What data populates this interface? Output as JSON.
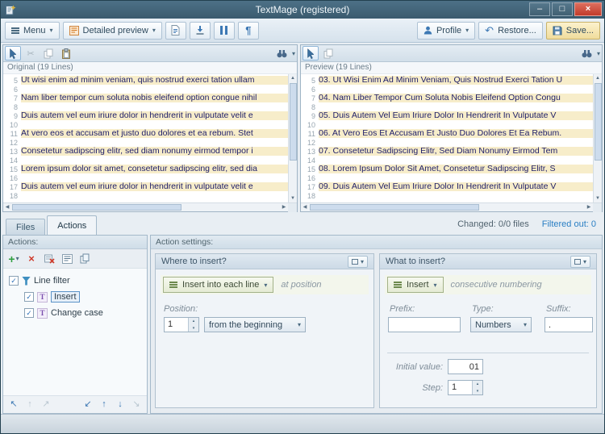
{
  "window": {
    "title": "TextMage (registered)"
  },
  "toolbar": {
    "menu": "Menu",
    "preview_mode": "Detailed preview",
    "profile": "Profile",
    "restore": "Restore...",
    "save": "Save..."
  },
  "panes": {
    "original": {
      "caption": "Original (19 Lines)",
      "lines": [
        {
          "num": "5",
          "text": "Ut wisi enim ad minim veniam, quis nostrud exerci tation ullam",
          "hl": true
        },
        {
          "num": "6",
          "text": "",
          "hl": false
        },
        {
          "num": "7",
          "text": "Nam liber tempor cum soluta nobis eleifend option congue nihil",
          "hl": true
        },
        {
          "num": "8",
          "text": "",
          "hl": false
        },
        {
          "num": "9",
          "text": "Duis autem vel eum iriure dolor in hendrerit in vulputate velit e",
          "hl": true
        },
        {
          "num": "10",
          "text": "",
          "hl": false
        },
        {
          "num": "11",
          "text": "At vero eos et accusam et justo duo dolores et ea rebum. Stet",
          "hl": true
        },
        {
          "num": "12",
          "text": "",
          "hl": false
        },
        {
          "num": "13",
          "text": "Consetetur sadipscing elitr, sed diam nonumy eirmod tempor i",
          "hl": true
        },
        {
          "num": "14",
          "text": "",
          "hl": false
        },
        {
          "num": "15",
          "text": "Lorem ipsum dolor sit amet, consetetur sadipscing elitr, sed dia",
          "hl": true
        },
        {
          "num": "16",
          "text": "",
          "hl": false
        },
        {
          "num": "17",
          "text": "Duis autem vel eum iriure dolor in hendrerit in vulputate velit e",
          "hl": true
        },
        {
          "num": "18",
          "text": "",
          "hl": false
        }
      ]
    },
    "preview": {
      "caption": "Preview (19 Lines)",
      "lines": [
        {
          "num": "5",
          "text": "03. Ut Wisi Enim Ad Minim Veniam, Quis Nostrud Exerci Tation U",
          "hl": true
        },
        {
          "num": "6",
          "text": "",
          "hl": false
        },
        {
          "num": "7",
          "text": "04. Nam Liber Tempor Cum Soluta Nobis Eleifend Option Congu",
          "hl": true
        },
        {
          "num": "8",
          "text": "",
          "hl": false
        },
        {
          "num": "9",
          "text": "05. Duis Autem Vel Eum Iriure Dolor In Hendrerit In Vulputate V",
          "hl": true
        },
        {
          "num": "10",
          "text": "",
          "hl": false
        },
        {
          "num": "11",
          "text": "06. At Vero Eos Et Accusam Et Justo Duo Dolores Et Ea Rebum.",
          "hl": true
        },
        {
          "num": "12",
          "text": "",
          "hl": false
        },
        {
          "num": "13",
          "text": "07. Consetetur Sadipscing Elitr, Sed Diam Nonumy Eirmod Tem",
          "hl": true
        },
        {
          "num": "14",
          "text": "",
          "hl": false
        },
        {
          "num": "15",
          "text": "08. Lorem Ipsum Dolor Sit Amet, Consetetur Sadipscing Elitr, S",
          "hl": true
        },
        {
          "num": "16",
          "text": "",
          "hl": false
        },
        {
          "num": "17",
          "text": "09. Duis Autem Vel Eum Iriure Dolor In Hendrerit In Vulputate V",
          "hl": true
        },
        {
          "num": "18",
          "text": "",
          "hl": false
        }
      ]
    }
  },
  "status_row": {
    "changed": "Changed: 0/0 files",
    "filtered": "Filtered out: 0"
  },
  "tabs": {
    "files": "Files",
    "actions": "Actions"
  },
  "actions_panel": {
    "header": "Actions:",
    "tree": [
      {
        "label": "Line filter",
        "level": 0,
        "checked": true,
        "selected": false
      },
      {
        "label": "Insert",
        "level": 1,
        "checked": true,
        "selected": true
      },
      {
        "label": "Change case",
        "level": 1,
        "checked": true,
        "selected": false
      }
    ]
  },
  "settings": {
    "header": "Action settings:",
    "where": {
      "title": "Where to insert?",
      "mode": "Insert into each line",
      "note": "at position",
      "position_label": "Position:",
      "position_value": "1",
      "from_value": "from the beginning"
    },
    "what": {
      "title": "What to insert?",
      "mode": "Insert",
      "note": "consecutive numbering",
      "prefix_label": "Prefix:",
      "prefix_value": "",
      "type_label": "Type:",
      "type_value": "Numbers",
      "suffix_label": "Suffix:",
      "suffix_value": ".",
      "initial_label": "Initial value:",
      "initial_value": "01",
      "step_label": "Step:",
      "step_value": "1"
    }
  },
  "icons": {
    "caret_down": "▾",
    "spin_up": "▴",
    "spin_down": "▾",
    "paragraph": "¶",
    "undo": "↶",
    "scissors": "✂",
    "check": "✓",
    "plus": "+",
    "cross": "×",
    "up": "▲",
    "down": "▼",
    "left": "◀",
    "right": "▶",
    "arrow_up": "↑",
    "arrow_down": "↓",
    "arrow_up_left": "↖",
    "arrow_up_right": "↗",
    "arrow_down_left": "↙",
    "arrow_down_right": "↘",
    "minimize": "–",
    "maximize": "□",
    "close": "×"
  }
}
